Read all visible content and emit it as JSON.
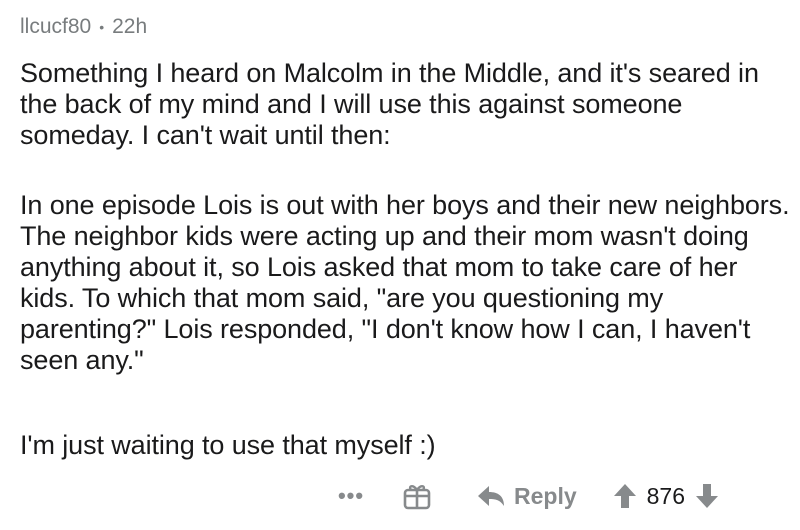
{
  "comment": {
    "username": "llcucf80",
    "separator": "•",
    "time_ago": "22h",
    "paragraphs": [
      "Something I heard on Malcolm in the Middle, and it's seared in the back of my mind and I will use this against someone someday.  I can't wait until then:",
      "In one episode Lois is out with her boys and their new neighbors.  The neighbor kids were acting up and their mom wasn't doing anything about it, so Lois asked that mom to take care of her kids.  To which that mom said, \"are you questioning my parenting?\"  Lois responded, \"I don't know how I can, I haven't seen any.\"",
      "I'm just waiting to use that myself :)"
    ]
  },
  "actions": {
    "more_label": "•••",
    "reply_label": "Reply",
    "score": "876",
    "icons": [
      "more-icon",
      "award-icon",
      "reply-icon",
      "upvote-icon",
      "downvote-icon"
    ]
  },
  "colors": {
    "text": "#1a1a1b",
    "meta": "#787c7e",
    "action": "#878a8c"
  }
}
